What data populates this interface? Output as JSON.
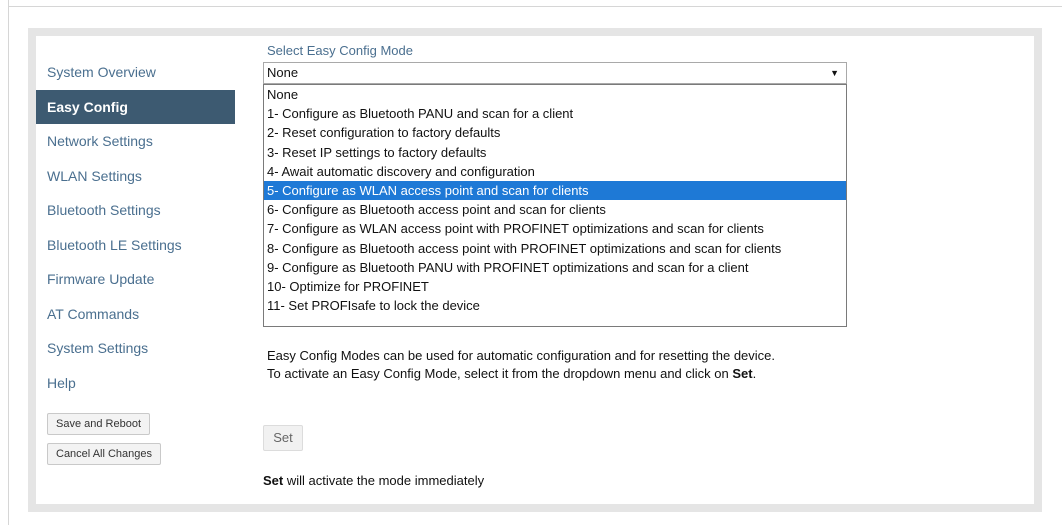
{
  "sidebar": {
    "items": [
      {
        "label": "System Overview",
        "active": false
      },
      {
        "label": "Easy Config",
        "active": true
      },
      {
        "label": "Network Settings",
        "active": false
      },
      {
        "label": "WLAN Settings",
        "active": false
      },
      {
        "label": "Bluetooth Settings",
        "active": false
      },
      {
        "label": "Bluetooth LE Settings",
        "active": false
      },
      {
        "label": "Firmware Update",
        "active": false
      },
      {
        "label": "AT Commands",
        "active": false
      },
      {
        "label": "System Settings",
        "active": false
      },
      {
        "label": "Help",
        "active": false
      }
    ],
    "save_reboot_label": "Save and Reboot",
    "cancel_changes_label": "Cancel All Changes"
  },
  "main": {
    "mode_label": "Select Easy Config Mode",
    "selected_value": "None",
    "options": [
      "None",
      "1- Configure as Bluetooth PANU and scan for a client",
      "2- Reset configuration to factory defaults",
      "3- Reset IP settings to factory defaults",
      "4- Await automatic discovery and configuration",
      "5- Configure as WLAN access point and scan for clients",
      "6- Configure as Bluetooth access point and scan for clients",
      "7- Configure as WLAN access point with PROFINET optimizations and scan for clients",
      "8- Configure as Bluetooth access point with PROFINET optimizations and scan for clients",
      "9- Configure as Bluetooth PANU with PROFINET optimizations and scan for a client",
      "10- Optimize for PROFINET",
      "11- Set PROFIsafe to lock the device"
    ],
    "highlighted_option": "5- Configure as WLAN access point and scan for clients",
    "description_line1": "Easy Config Modes can be used for automatic configuration and for resetting the device.",
    "description_line2_pre": "To activate an Easy Config Mode, select it from the dropdown menu and click on ",
    "description_line2_bold": "Set",
    "description_line2_post": ".",
    "set_button_label": "Set",
    "note_bold": "Set",
    "note_rest": " will activate the mode immediately"
  },
  "colors": {
    "sidebar_active_bg": "#3d5a71",
    "sidebar_link": "#4a6f8f",
    "highlight": "#1e79d6",
    "shell_bg": "#e5e5e5"
  },
  "icons": {
    "select_arrow": "dropdown-arrow-icon"
  }
}
